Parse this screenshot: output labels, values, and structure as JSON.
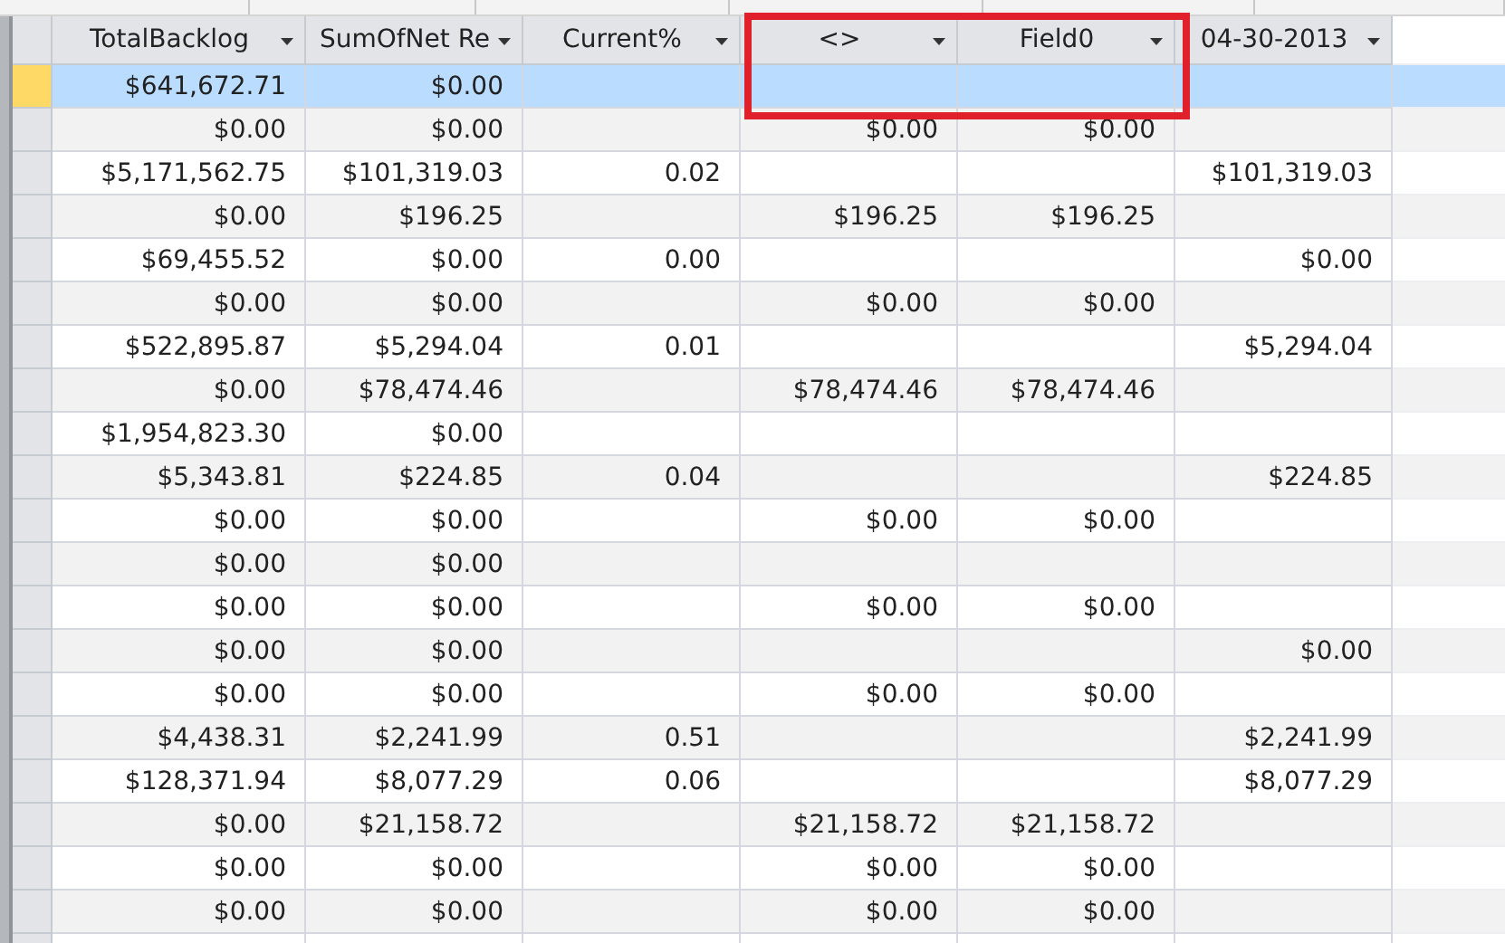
{
  "table": {
    "columns": [
      {
        "label": "TotalBacklog",
        "highlighted": false
      },
      {
        "label": "SumOfNet Re",
        "highlighted": false
      },
      {
        "label": "Current%",
        "highlighted": false
      },
      {
        "label": "<>",
        "highlighted": true
      },
      {
        "label": "Field0",
        "highlighted": true
      },
      {
        "label": "04-30-2013",
        "highlighted": false
      }
    ],
    "rows": [
      {
        "selected": true,
        "cells": [
          "$641,672.71",
          "$0.00",
          null,
          null,
          null,
          null
        ]
      },
      {
        "selected": false,
        "cells": [
          "$0.00",
          "$0.00",
          null,
          "$0.00",
          "$0.00",
          null
        ]
      },
      {
        "selected": false,
        "cells": [
          "$5,171,562.75",
          "$101,319.03",
          "0.02",
          null,
          null,
          "$101,319.03"
        ]
      },
      {
        "selected": false,
        "cells": [
          "$0.00",
          "$196.25",
          null,
          "$196.25",
          "$196.25",
          null
        ]
      },
      {
        "selected": false,
        "cells": [
          "$69,455.52",
          "$0.00",
          "0.00",
          null,
          null,
          "$0.00"
        ]
      },
      {
        "selected": false,
        "cells": [
          "$0.00",
          "$0.00",
          null,
          "$0.00",
          "$0.00",
          null
        ]
      },
      {
        "selected": false,
        "cells": [
          "$522,895.87",
          "$5,294.04",
          "0.01",
          null,
          null,
          "$5,294.04"
        ]
      },
      {
        "selected": false,
        "cells": [
          "$0.00",
          "$78,474.46",
          null,
          "$78,474.46",
          "$78,474.46",
          null
        ]
      },
      {
        "selected": false,
        "cells": [
          "$1,954,823.30",
          "$0.00",
          null,
          null,
          null,
          null
        ]
      },
      {
        "selected": false,
        "cells": [
          "$5,343.81",
          "$224.85",
          "0.04",
          null,
          null,
          "$224.85"
        ]
      },
      {
        "selected": false,
        "cells": [
          "$0.00",
          "$0.00",
          null,
          "$0.00",
          "$0.00",
          null
        ]
      },
      {
        "selected": false,
        "cells": [
          "$0.00",
          "$0.00",
          null,
          null,
          null,
          null
        ]
      },
      {
        "selected": false,
        "cells": [
          "$0.00",
          "$0.00",
          null,
          "$0.00",
          "$0.00",
          null
        ]
      },
      {
        "selected": false,
        "cells": [
          "$0.00",
          "$0.00",
          null,
          null,
          null,
          "$0.00"
        ]
      },
      {
        "selected": false,
        "cells": [
          "$0.00",
          "$0.00",
          null,
          "$0.00",
          "$0.00",
          null
        ]
      },
      {
        "selected": false,
        "cells": [
          "$4,438.31",
          "$2,241.99",
          "0.51",
          null,
          null,
          "$2,241.99"
        ]
      },
      {
        "selected": false,
        "cells": [
          "$128,371.94",
          "$8,077.29",
          "0.06",
          null,
          null,
          "$8,077.29"
        ]
      },
      {
        "selected": false,
        "cells": [
          "$0.00",
          "$21,158.72",
          null,
          "$21,158.72",
          "$21,158.72",
          null
        ]
      },
      {
        "selected": false,
        "cells": [
          "$0.00",
          "$0.00",
          null,
          "$0.00",
          "$0.00",
          null
        ]
      },
      {
        "selected": false,
        "cells": [
          "$0.00",
          "$0.00",
          null,
          "$0.00",
          "$0.00",
          null
        ]
      }
    ]
  }
}
